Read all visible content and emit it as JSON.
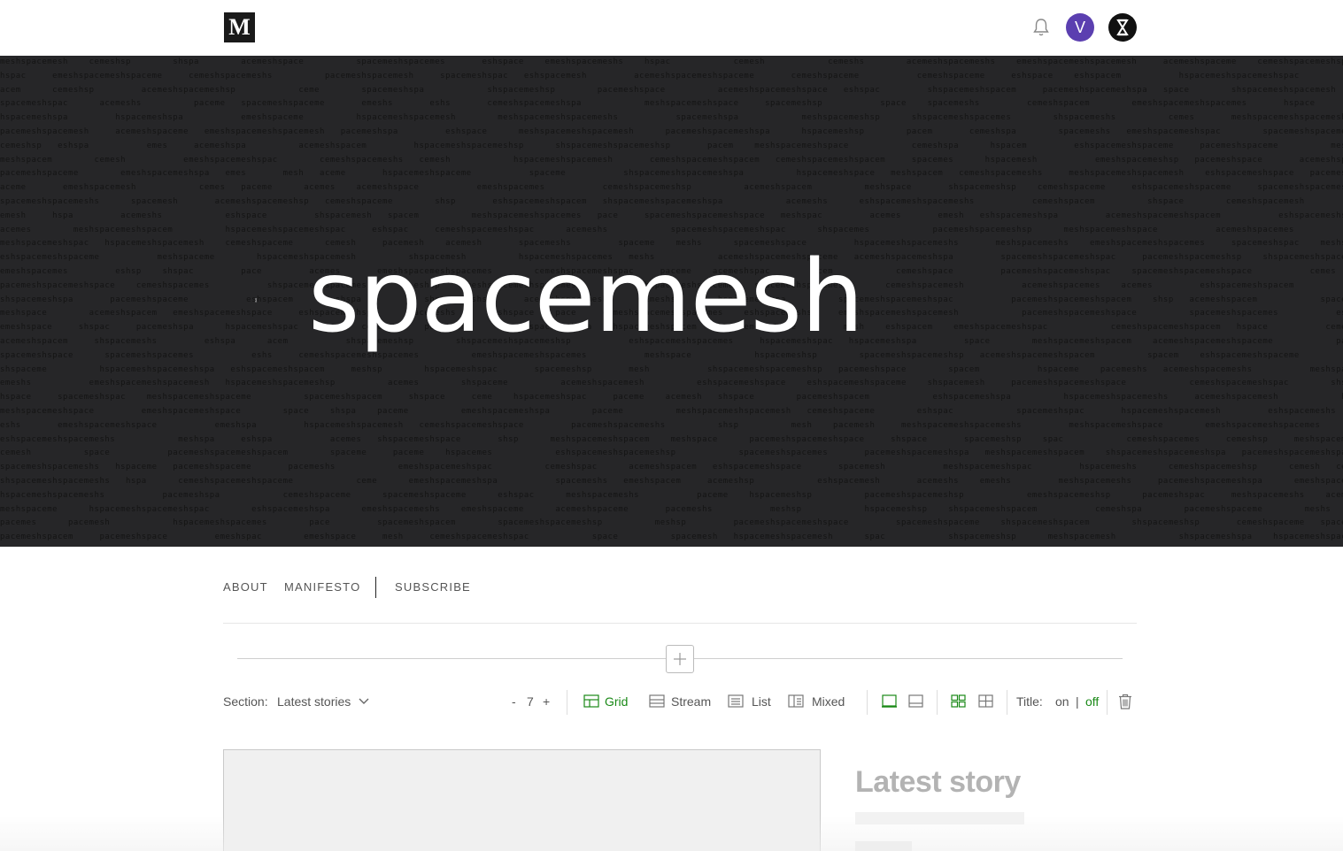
{
  "topbar": {
    "logo_letter": "M",
    "avatar_letter": "V"
  },
  "hero": {
    "brand": "spacemesh",
    "pattern_text": "spacemesh"
  },
  "nav": {
    "items": [
      "ABOUT",
      "MANIFESTO",
      "SUBSCRIBE"
    ]
  },
  "toolbar": {
    "section_label": "Section:",
    "section_value": "Latest stories",
    "minus": "-",
    "count": "7",
    "plus": "+",
    "layouts": [
      {
        "label": "Grid",
        "active": true
      },
      {
        "label": "Stream",
        "active": false
      },
      {
        "label": "List",
        "active": false
      },
      {
        "label": "Mixed",
        "active": false
      }
    ],
    "title_label": "Title:",
    "title_on": "on",
    "title_sep": "|",
    "title_off": "off"
  },
  "content": {
    "latest_heading": "Latest story"
  },
  "colors": {
    "accent": "#1a8917",
    "hero_bg": "#262628",
    "avatar_bg": "#5b3fb0"
  },
  "icons": [
    "bell-icon",
    "publication-icon",
    "plus-icon",
    "chevron-down-icon",
    "grid-icon",
    "stream-icon",
    "list-icon",
    "mixed-icon",
    "trash-icon"
  ]
}
